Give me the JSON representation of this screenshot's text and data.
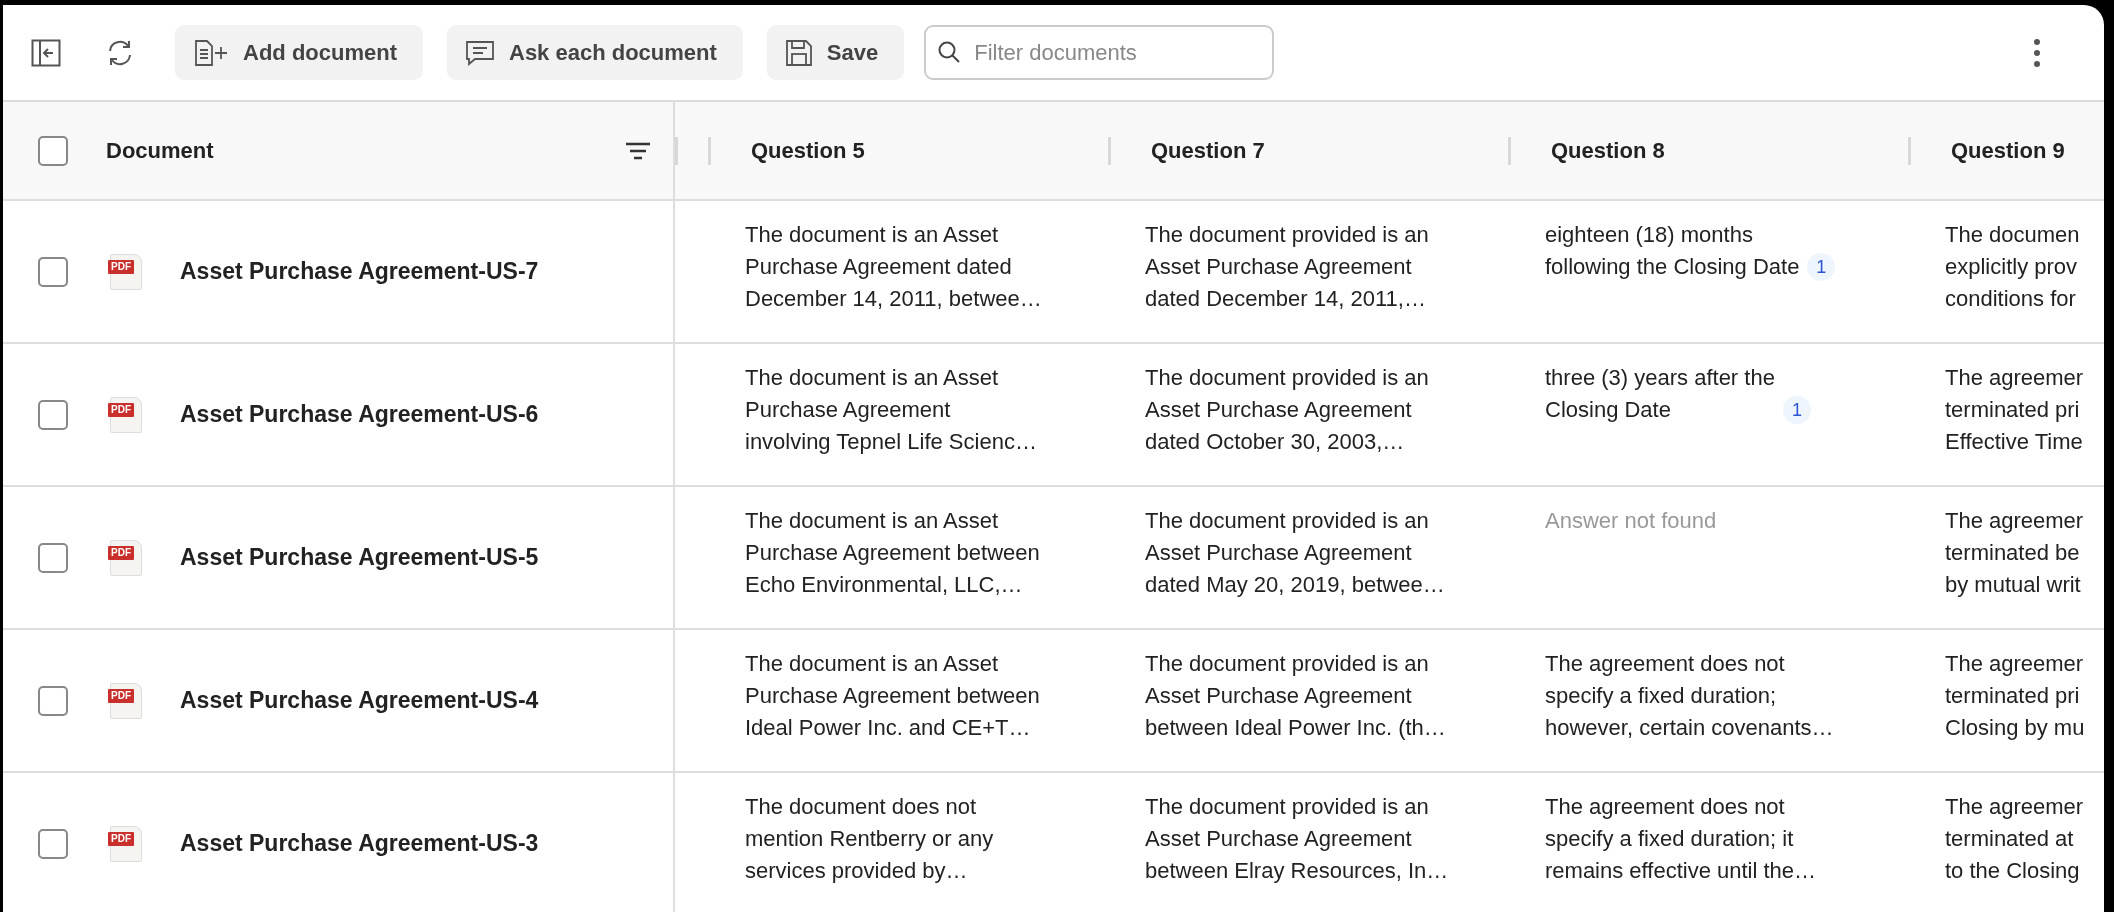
{
  "toolbar": {
    "buttons": [
      {
        "kind": "add",
        "label": "Add document"
      },
      {
        "kind": "ask",
        "label": "Ask each document"
      },
      {
        "kind": "save",
        "label": "Save"
      }
    ],
    "search": {
      "placeholder": "Filter documents"
    }
  },
  "table": {
    "select_all": {
      "checked": false
    },
    "document_column": "Document",
    "question_columns": [
      "Question 5",
      "Question 7",
      "Question 8",
      "Question 9"
    ],
    "rows": [
      {
        "checked": false,
        "file_type": "PDF",
        "document": "Asset Purchase Agreement-US-7",
        "cells": [
          {
            "text": "The document is an Asset\nPurchase Agreement dated\nDecember 14, 2011, betwee…",
            "found": true
          },
          {
            "text": "The document provided is an\nAsset Purchase Agreement\ndated December 14, 2011,…",
            "found": true
          },
          {
            "text": "eighteen (18) months\nfollowing the Closing Date",
            "found": true,
            "citation": "1"
          },
          {
            "text": "The documen\nexplicitly prov\nconditions for",
            "found": true
          }
        ]
      },
      {
        "checked": false,
        "file_type": "PDF",
        "document": "Asset Purchase Agreement-US-6",
        "cells": [
          {
            "text": "The document is an Asset\nPurchase Agreement\ninvolving Tepnel Life Scienc…",
            "found": true
          },
          {
            "text": "The document provided is an\nAsset Purchase Agreement\ndated October 30, 2003,…",
            "found": true
          },
          {
            "text": "three (3) years after the\nClosing Date",
            "found": true,
            "citation": "1"
          },
          {
            "text": "The agreemer\nterminated pri\nEffective Time",
            "found": true
          }
        ]
      },
      {
        "checked": false,
        "file_type": "PDF",
        "document": "Asset Purchase Agreement-US-5",
        "cells": [
          {
            "text": "The document is an Asset\nPurchase Agreement between\nEcho Environmental, LLC,…",
            "found": true
          },
          {
            "text": "The document provided is an\nAsset Purchase Agreement\ndated May 20, 2019, betwee…",
            "found": true
          },
          {
            "text": "Answer not found",
            "found": false
          },
          {
            "text": "The agreemer\nterminated be\nby mutual writ",
            "found": true
          }
        ]
      },
      {
        "checked": false,
        "file_type": "PDF",
        "document": "Asset Purchase Agreement-US-4",
        "cells": [
          {
            "text": "The document is an Asset\nPurchase Agreement between\nIdeal Power Inc. and CE+T…",
            "found": true
          },
          {
            "text": "The document provided is an\nAsset Purchase Agreement\nbetween Ideal Power Inc. (th…",
            "found": true
          },
          {
            "text": "The agreement does not\nspecify a fixed duration;\nhowever, certain covenants…",
            "found": true
          },
          {
            "text": "The agreemer\nterminated pri\nClosing by mu",
            "found": true
          }
        ]
      },
      {
        "checked": false,
        "file_type": "PDF",
        "document": "Asset Purchase Agreement-US-3",
        "cells": [
          {
            "text": "The document does not\nmention Rentberry or any\nservices provided by…",
            "found": true
          },
          {
            "text": "The document provided is an\nAsset Purchase Agreement\nbetween Elray Resources, In…",
            "found": true
          },
          {
            "text": "The agreement does not\nspecify a fixed duration; it\nremains effective until the…",
            "found": true
          },
          {
            "text": "The agreemer\nterminated at\nto the Closing",
            "found": true
          }
        ]
      }
    ]
  }
}
